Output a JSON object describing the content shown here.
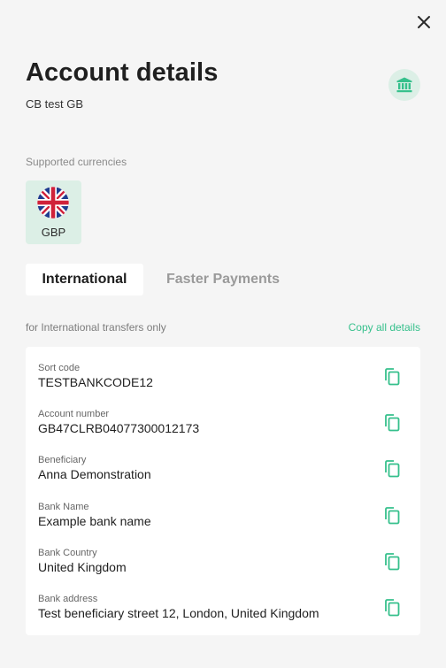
{
  "modal": {
    "title": "Account details",
    "subtitle": "CB test GB"
  },
  "icons": {
    "close": "close-icon",
    "bank": "bank-icon",
    "flag": "uk-flag-icon",
    "copy": "copy-icon"
  },
  "currencies": {
    "label": "Supported currencies",
    "items": [
      {
        "code": "GBP"
      }
    ]
  },
  "tabs": [
    {
      "label": "International",
      "active": true
    },
    {
      "label": "Faster Payments",
      "active": false
    }
  ],
  "details": {
    "note": "for International transfers only",
    "copy_all_label": "Copy all details",
    "rows": [
      {
        "label": "Sort code",
        "value": "TESTBANKCODE12"
      },
      {
        "label": "Account number",
        "value": "GB47CLRB04077300012173"
      },
      {
        "label": "Beneficiary",
        "value": "Anna Demonstration"
      },
      {
        "label": "Bank Name",
        "value": "Example bank name"
      },
      {
        "label": "Bank Country",
        "value": "United Kingdom"
      },
      {
        "label": "Bank address",
        "value": "Test beneficiary street 12, London, United Kingdom"
      }
    ]
  },
  "colors": {
    "accent": "#36c08c",
    "badge_bg": "#dcefe6",
    "background": "#f5f5f5",
    "card": "#ffffff"
  }
}
